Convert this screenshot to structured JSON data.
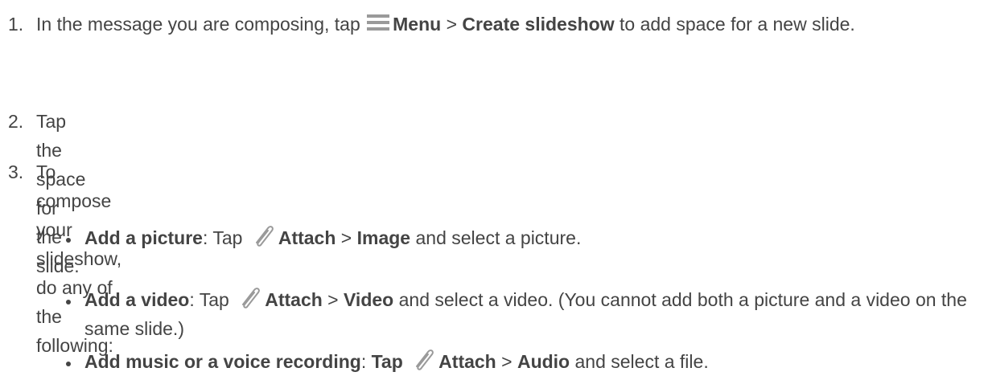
{
  "steps": [
    {
      "num": "1.",
      "pre": "In the message you are composing, tap",
      "b1": "Menu",
      "sep": ">",
      "b2": "Create slideshow",
      "post": "to add space for a new slide."
    },
    {
      "num": "2.",
      "text": "Tap the space for the slide."
    },
    {
      "num": "3.",
      "text": "To compose your slideshow, do any of the following:"
    }
  ],
  "bullets": [
    {
      "title": "Add a picture",
      "colon": ":",
      "tap": "Tap",
      "attach": "Attach",
      "sep": ">",
      "target": "Image",
      "post": "and select a picture."
    },
    {
      "title": "Add a video",
      "colon": ":",
      "tap": "Tap",
      "attach": "Attach",
      "sep": ">",
      "target": "Video",
      "post": "and select a video. (You cannot add both a picture and a video on the same slide.)"
    },
    {
      "title": "Add music or a voice recording",
      "colon": ":",
      "tap": "Tap",
      "attach": "Attach",
      "sep": ">",
      "target": "Audio",
      "post": "and select a file."
    }
  ],
  "icons": {
    "menu": "menu-icon",
    "attach": "paperclip-icon",
    "icon_color": "#9a9a9a",
    "text_color": "#444444"
  }
}
